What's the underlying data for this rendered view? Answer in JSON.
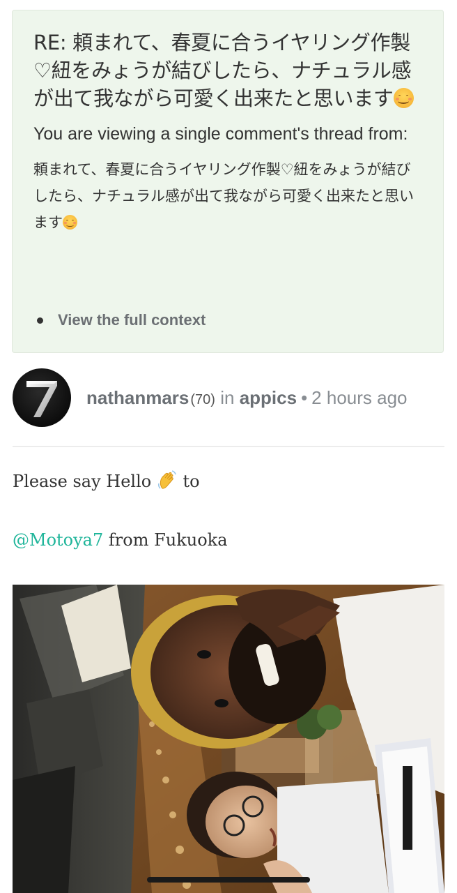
{
  "notice": {
    "title_text": "RE: 頼まれて、春夏に合うイヤリング作製♡紐をみょうが結びしたら、ナチュラル感が出て我ながら可愛く出来たと思います",
    "subtitle": "You are viewing a single comment's thread from:",
    "quote_text": "頼まれて、春夏に合うイヤリング作製♡紐をみょうが結びしたら、ナチュラル感が出て我ながら可愛く出来たと思います",
    "context_link": "View the full context",
    "emoji_icon": "smiling-face-icon",
    "background_color": "#eef6ec"
  },
  "post": {
    "author": "nathanmars",
    "reputation": "(70)",
    "in_label": "in",
    "community": "appics",
    "separator": "•",
    "timestamp": "2 hours ago",
    "avatar_icon": "seven-logo-avatar",
    "body_line1_before": "Please say Hello",
    "body_line1_after": "to",
    "wave_icon": "waving-hand-icon",
    "mention": "@Motoya7",
    "body_line2_after": " from Fukuoka",
    "mention_color": "#1fb59a"
  }
}
